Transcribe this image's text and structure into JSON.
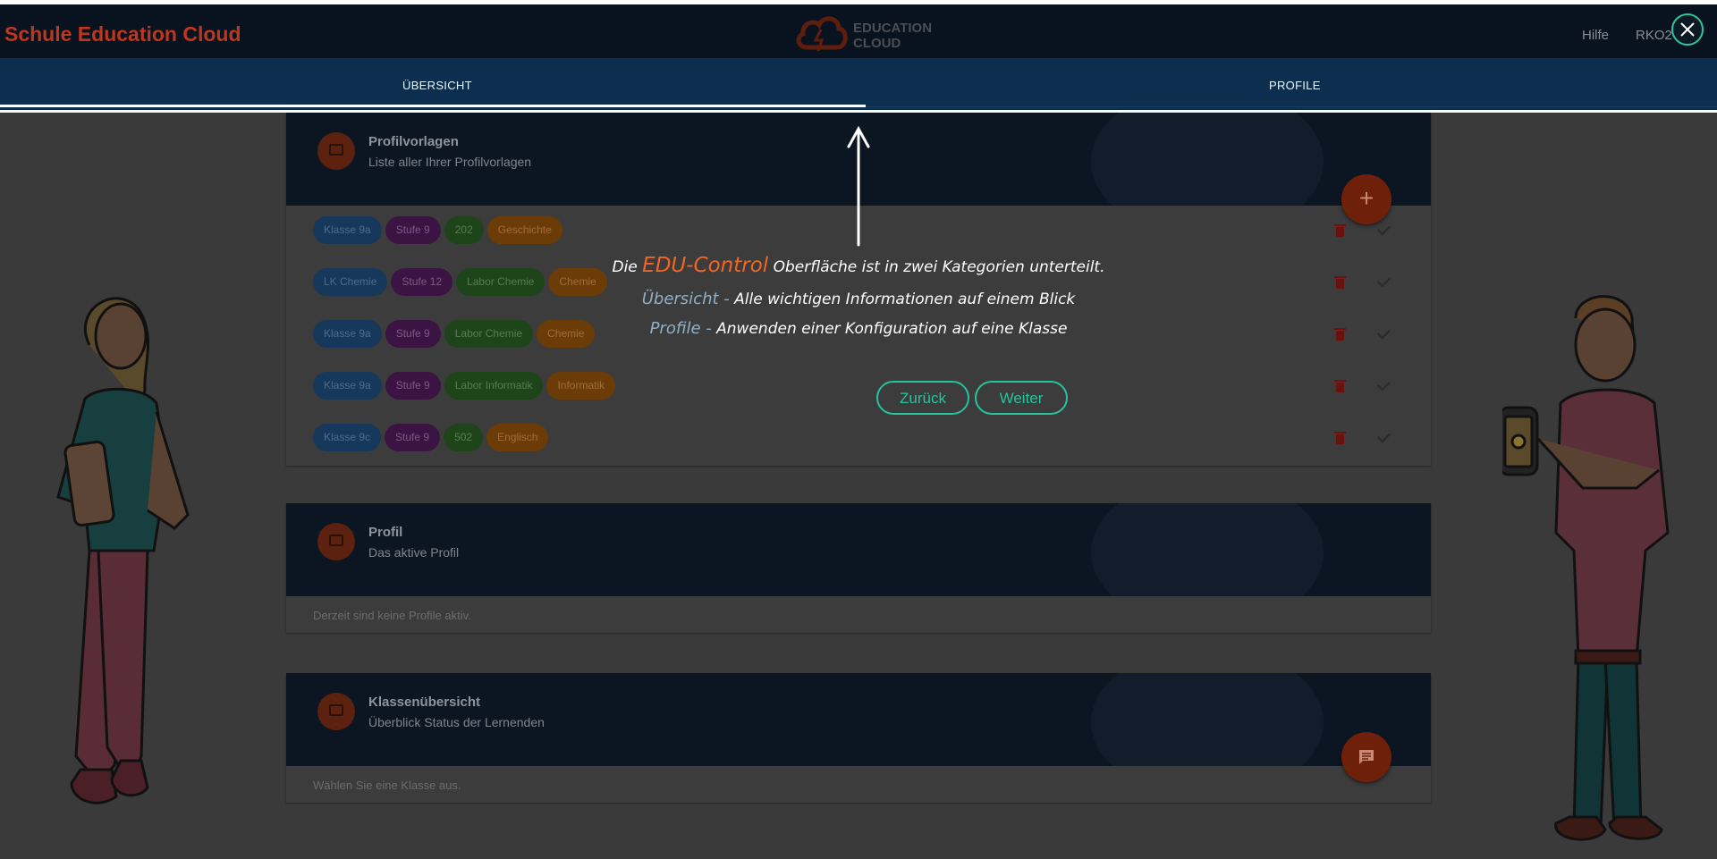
{
  "header": {
    "brand": "Schule Education Cloud",
    "logo_text": [
      "EDUCATION",
      "CLOUD"
    ],
    "help": "Hilfe",
    "user": "RKO2",
    "close_icon": "close-icon"
  },
  "tabs": [
    {
      "label": "ÜBERSICHT",
      "active": true
    },
    {
      "label": "PROFILE",
      "active": false
    }
  ],
  "cards": {
    "templates": {
      "title": "Profilvorlagen",
      "subtitle": "Liste aller Ihrer Profilvorlagen",
      "add_icon": "+",
      "rows": [
        {
          "chips": [
            "Klasse 9a",
            "Stufe 9",
            "202",
            "Geschichte"
          ]
        },
        {
          "chips": [
            "LK Chemie",
            "Stufe 12",
            "Labor Chemie",
            "Chemie"
          ]
        },
        {
          "chips": [
            "Klasse 9a",
            "Stufe 9",
            "Labor Chemie",
            "Chemie"
          ]
        },
        {
          "chips": [
            "Klasse 9a",
            "Stufe 9",
            "Labor Informatik",
            "Informatik"
          ]
        },
        {
          "chips": [
            "Klasse 9c",
            "Stufe 9",
            "502",
            "Englisch"
          ]
        }
      ]
    },
    "profile": {
      "title": "Profil",
      "subtitle": "Das aktive Profil",
      "body": "Derzeit sind keine Profile aktiv."
    },
    "classes": {
      "title": "Klassenübersicht",
      "subtitle": "Überblick Status der Lernenden",
      "body": "Wählen Sie eine Klasse aus."
    }
  },
  "tour": {
    "line1_pre": "Die",
    "line1_brand": "EDU-Control",
    "line1_post": "Oberfläche ist in zwei Kategorien unterteilt.",
    "line2_key": "Übersicht -",
    "line2_text": "Alle wichtigen Informationen auf einem Blick",
    "line3_key": "Profile -",
    "line3_text": "Anwenden einer Konfiguration auf eine Klasse",
    "back": "Zurück",
    "next": "Weiter"
  },
  "colors": {
    "accent": "#27c39a",
    "brand_orange": "#f26522",
    "header_bg": "#09121f",
    "tabs_bg": "#0c2f50"
  }
}
